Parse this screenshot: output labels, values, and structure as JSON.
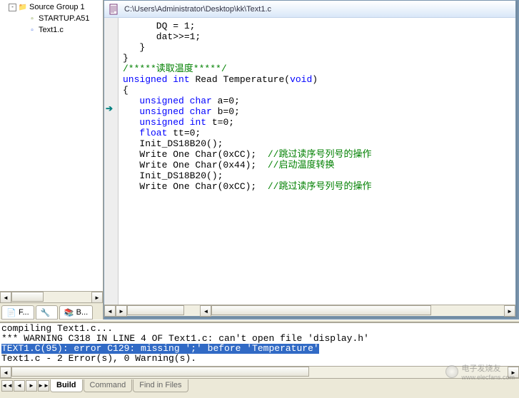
{
  "tree": {
    "group": {
      "label": "Source Group 1",
      "toggle": "-"
    },
    "items": [
      {
        "label": "STARTUP.A51",
        "icon": "asm"
      },
      {
        "label": "Text1.c",
        "icon": "c"
      }
    ]
  },
  "left_tabs": [
    {
      "label": "F..."
    },
    {
      "label": ""
    },
    {
      "label": "B..."
    }
  ],
  "editor": {
    "title": "C:\\Users\\Administrator\\Desktop\\kk\\Text1.c",
    "code": {
      "l1_a": "      DQ = 1;",
      "l2_a": "      dat>>=1;",
      "l3_a": "   }",
      "l4_a": "}",
      "cmt1": "/*****读取温度*****/",
      "fn_kw1": "unsigned",
      "fn_kw2": "int",
      "fn_name": " Read Temperature(",
      "fn_kw3": "void",
      "fn_close": ")",
      "brace_o": "{",
      "d1a": "unsigned",
      "d1b": "char",
      "d1c": " a=0;",
      "d2a": "unsigned",
      "d2b": "char",
      "d2c": " b=0;",
      "d3a": "unsigned",
      "d3b": "int",
      "d3c": " t=0;",
      "d4a": "float",
      "d4b": " tt=0;",
      "s1": "   Init_DS18B20();",
      "s2": "   Write One Char(0xCC);",
      "s2c": "  //跳过读序号列号的操作",
      "s3": "   Write One Char(0x44);",
      "s3c": "  //启动温度转换",
      "s4": "   Init_DS18B20();",
      "s5": "   Write One Char(0xCC);",
      "s5c": "  //跳过读序号列号的操作"
    }
  },
  "output": {
    "l1": "compiling Text1.c...",
    "l2": "*** WARNING C318 IN LINE 4 OF Text1.c: can't open file 'display.h'",
    "l3": "TEXT1.C(95): error C129: missing ';' before 'Temperature'",
    "l4": "Text1.c - 2 Error(s), 0 Warning(s)."
  },
  "bottom_tabs": {
    "nav": [
      "◄◄",
      "◄",
      "►",
      "►►"
    ],
    "tabs": [
      {
        "label": "Build",
        "active": true
      },
      {
        "label": "Command",
        "active": false
      },
      {
        "label": "Find in Files",
        "active": false
      }
    ]
  },
  "watermark": {
    "text": "电子发烧友",
    "url": "www.elecfans.com"
  }
}
